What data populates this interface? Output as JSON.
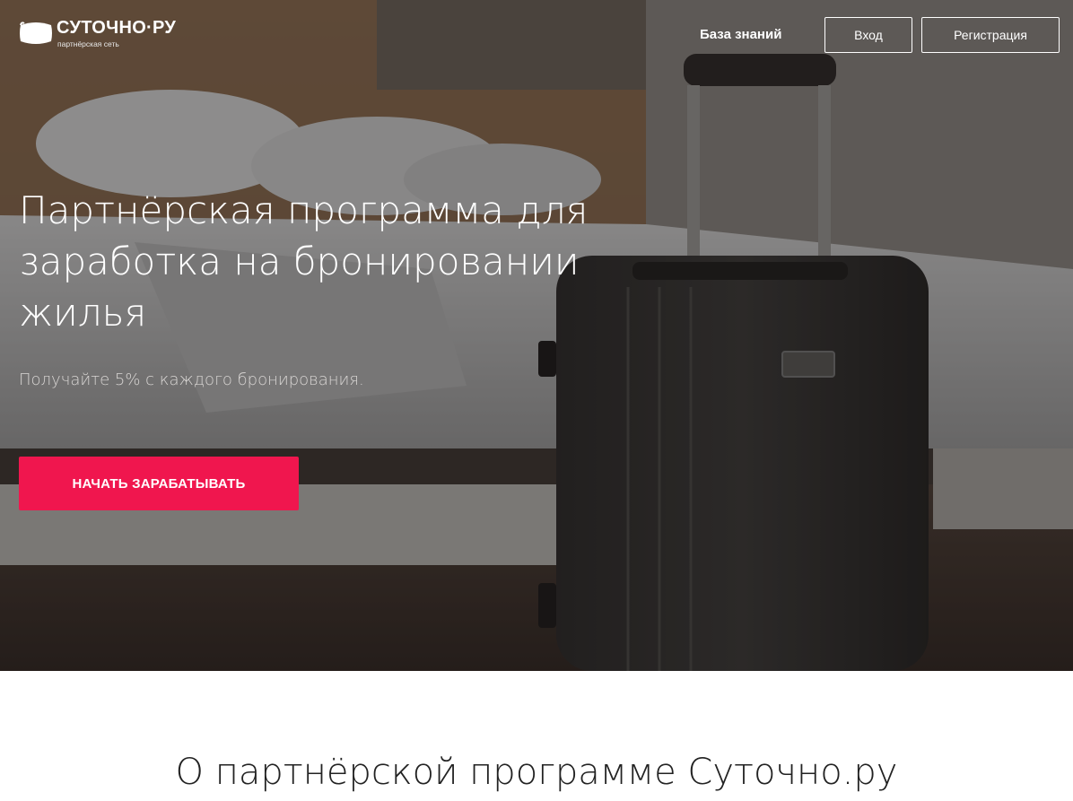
{
  "header": {
    "logo_title": "СУТОЧНО·РУ",
    "logo_subtitle": "партнёрская сеть",
    "knowledge_base": "База знаний",
    "login": "Вход",
    "register": "Регистрация"
  },
  "hero": {
    "title": "Партнёрская программа для заработка на бронировании жилья",
    "subtitle": "Получайте 5% с каждого бронирования.",
    "cta": "НАЧАТЬ ЗАРАБАТЫВАТЬ"
  },
  "about": {
    "title": "О партнёрской программе Суточно.ру"
  },
  "colors": {
    "accent": "#f0164e"
  }
}
